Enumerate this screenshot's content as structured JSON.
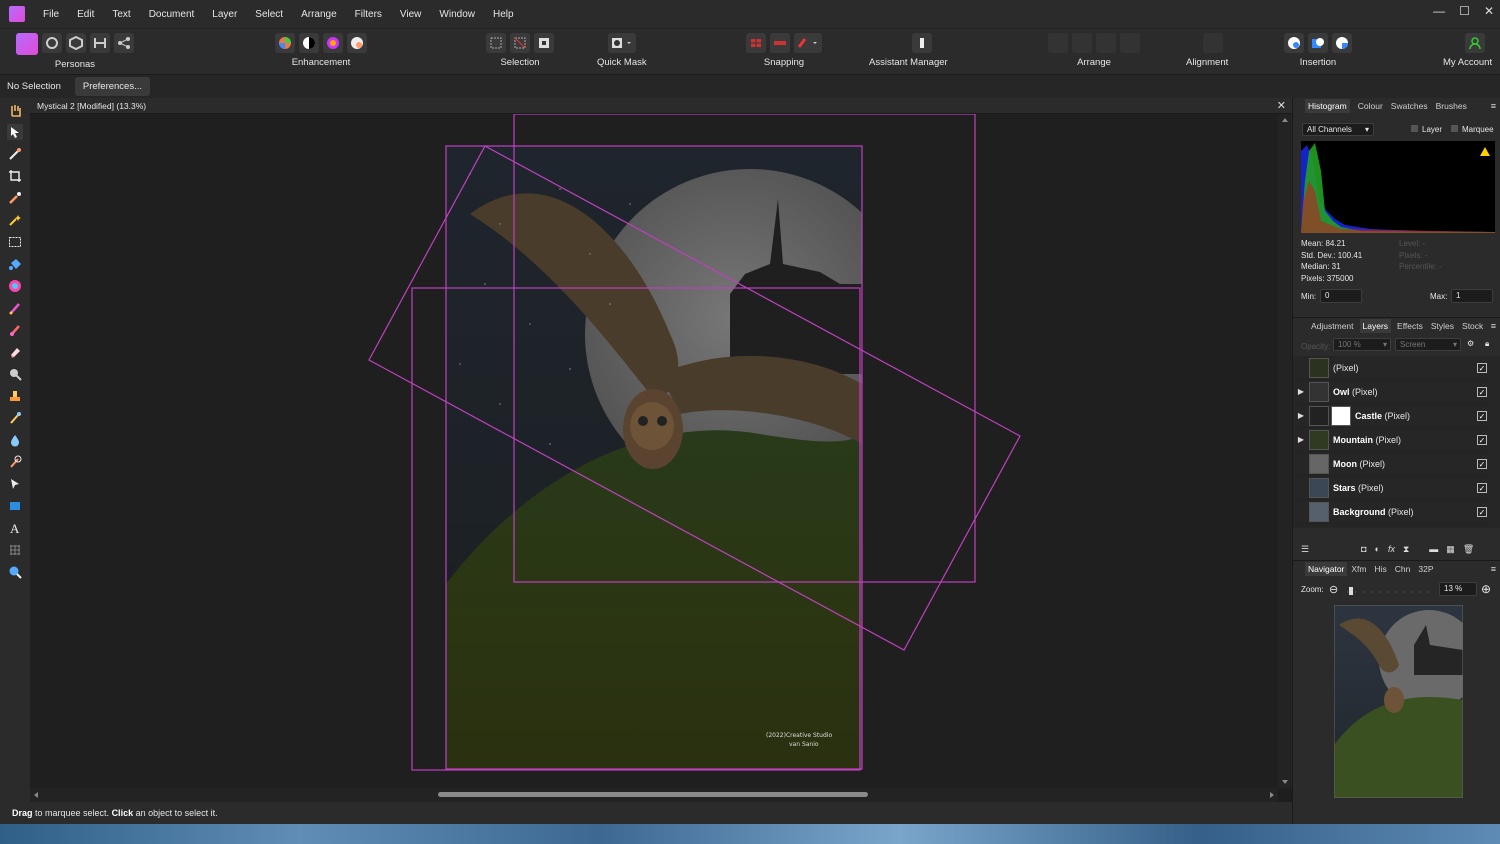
{
  "menubar": {
    "items": [
      "File",
      "Edit",
      "Text",
      "Document",
      "Layer",
      "Select",
      "Arrange",
      "Filters",
      "View",
      "Window",
      "Help"
    ],
    "window_controls": [
      "—",
      "☐",
      "✕"
    ]
  },
  "toolbar": {
    "groups": [
      {
        "label": "Personas"
      },
      {
        "label": "Enhancement"
      },
      {
        "label": "Selection"
      },
      {
        "label": "Quick Mask"
      },
      {
        "label": "Snapping"
      },
      {
        "label": "Assistant Manager"
      },
      {
        "label": "Arrange"
      },
      {
        "label": "Alignment"
      },
      {
        "label": "Insertion"
      },
      {
        "label": "My Account"
      }
    ]
  },
  "contextbar": {
    "status": "No Selection",
    "preferences_label": "Preferences..."
  },
  "document": {
    "title": "Mystical 2 [Modified] (13.3%)",
    "close": "✕",
    "watermark_line1": "(2022)Creative Studio",
    "watermark_line2": "van Sanio"
  },
  "status_bar": {
    "bold1": "Drag",
    "text1": " to marquee select. ",
    "bold2": "Click",
    "text2": " an object to select it."
  },
  "histogram_panel": {
    "tabs": [
      "Histogram",
      "Colour",
      "Swatches",
      "Brushes"
    ],
    "channel": "All Channels",
    "layer_label": "Layer",
    "marquee_label": "Marquee",
    "mean": "Mean: 84.21",
    "std_dev": "Std. Dev.: 100.41",
    "median": "Median: 31",
    "pixels": "Pixels: 375000",
    "level": "Level: -",
    "pixels_right": "Pixels: -",
    "percentile": "Percentile: -",
    "min_label": "Min:",
    "min_value": "0",
    "max_label": "Max:",
    "max_value": "1"
  },
  "layers_panel": {
    "tabs": [
      "Adjustment",
      "Layers",
      "Effects",
      "Styles",
      "Stock"
    ],
    "opacity_label": "Opacity:",
    "opacity": "100 %",
    "blend_mode": "Screen",
    "layers": [
      {
        "name": "",
        "type": "(Pixel)",
        "expandable": false
      },
      {
        "name": "Owl",
        "type": " (Pixel)",
        "expandable": true
      },
      {
        "name": "Castle",
        "type": " (Pixel)",
        "expandable": true
      },
      {
        "name": "Mountain",
        "type": " (Pixel)",
        "expandable": true
      },
      {
        "name": "Moon",
        "type": " (Pixel)",
        "expandable": false
      },
      {
        "name": "Stars",
        "type": " (Pixel)",
        "expandable": false
      },
      {
        "name": "Background",
        "type": " (Pixel)",
        "expandable": false
      }
    ],
    "check": "✓"
  },
  "navigator_panel": {
    "tabs": [
      "Navigator",
      "Xfm",
      "His",
      "Chn",
      "32P"
    ],
    "zoom_label": "Zoom:",
    "zoom_value": "13 %"
  },
  "colors": {
    "accent": "#c040c0",
    "panel": "#2b2b2b",
    "canvas": "#1f1f1f"
  }
}
